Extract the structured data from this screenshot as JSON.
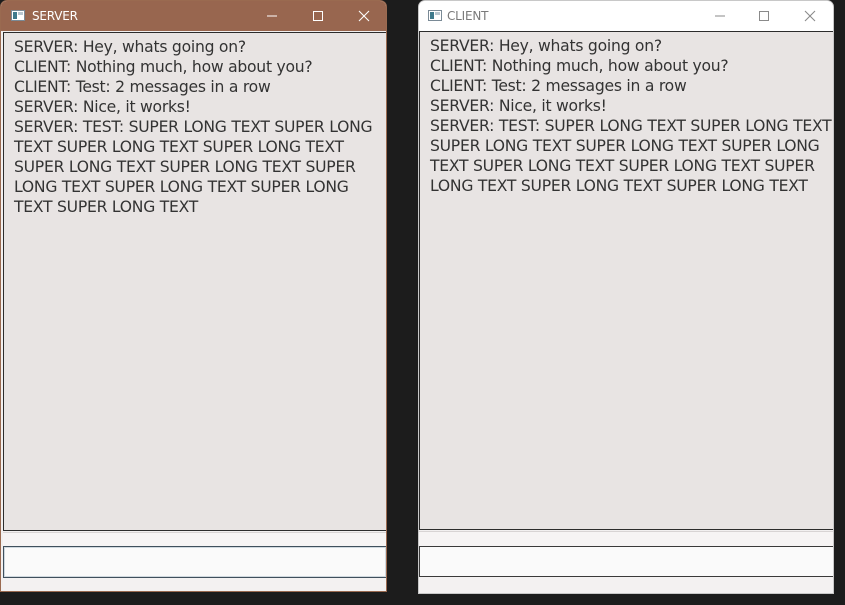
{
  "server": {
    "title": "SERVER",
    "messages": [
      "SERVER: Hey, whats going on?",
      "CLIENT: Nothing much, how about you?",
      "CLIENT: Test: 2 messages in a row",
      "SERVER: Nice, it works!",
      "SERVER: TEST: SUPER LONG TEXT SUPER LONG TEXT SUPER LONG TEXT SUPER LONG TEXT SUPER LONG TEXT SUPER LONG TEXT SUPER LONG TEXT SUPER LONG TEXT SUPER LONG TEXT SUPER LONG TEXT"
    ],
    "input_value": ""
  },
  "client": {
    "title": "CLIENT",
    "messages": [
      "SERVER: Hey, whats going on?",
      "CLIENT: Nothing much, how about you?",
      "CLIENT: Test: 2 messages in a row",
      "SERVER: Nice, it works!",
      "SERVER: TEST: SUPER LONG TEXT SUPER LONG TEXT SUPER LONG TEXT SUPER LONG TEXT SUPER LONG TEXT SUPER LONG TEXT SUPER LONG TEXT SUPER LONG TEXT SUPER LONG TEXT SUPER LONG TEXT"
    ],
    "input_value": ""
  },
  "colors": {
    "server_titlebar": "#98664f",
    "client_titlebar": "#ffffff",
    "chat_background": "#e8e4e3",
    "desktop_background": "#1c1c1c"
  },
  "icons": {
    "app": "app-window-icon",
    "minimize": "minimize-icon",
    "maximize": "maximize-icon",
    "close": "close-icon"
  }
}
